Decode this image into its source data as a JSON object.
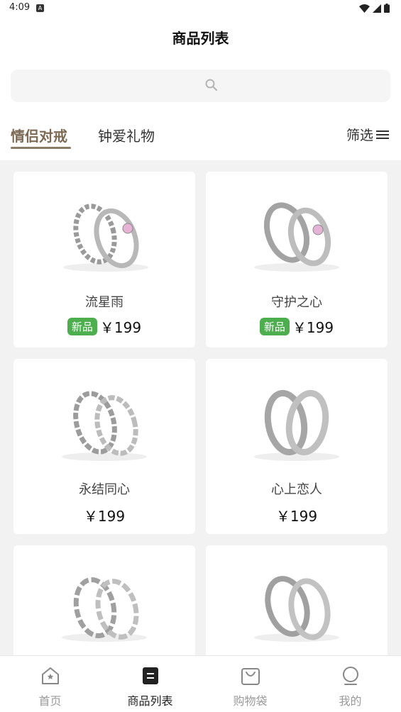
{
  "status": {
    "time": "4:09",
    "badge": "A"
  },
  "header": {
    "title": "商品列表"
  },
  "tabs": [
    {
      "label": "情侣对戒"
    },
    {
      "label": "钟爱礼物"
    }
  ],
  "filter": {
    "label": "筛选"
  },
  "products": [
    {
      "name": "流星雨",
      "price": "￥199",
      "badge": "新品"
    },
    {
      "name": "守护之心",
      "price": "￥199",
      "badge": "新品"
    },
    {
      "name": "永结同心",
      "price": "￥199"
    },
    {
      "name": "心上恋人",
      "price": "￥199"
    },
    {
      "name": "",
      "price": ""
    },
    {
      "name": "",
      "price": ""
    }
  ],
  "bottom_nav": [
    {
      "label": "首页",
      "icon": "home-icon"
    },
    {
      "label": "商品列表",
      "icon": "list-icon",
      "active": true
    },
    {
      "label": "购物袋",
      "icon": "bag-icon"
    },
    {
      "label": "我的",
      "icon": "profile-icon"
    }
  ],
  "colors": {
    "accent": "#7c6a55",
    "badge": "#4cae4c",
    "background": "#f2f2f2"
  }
}
